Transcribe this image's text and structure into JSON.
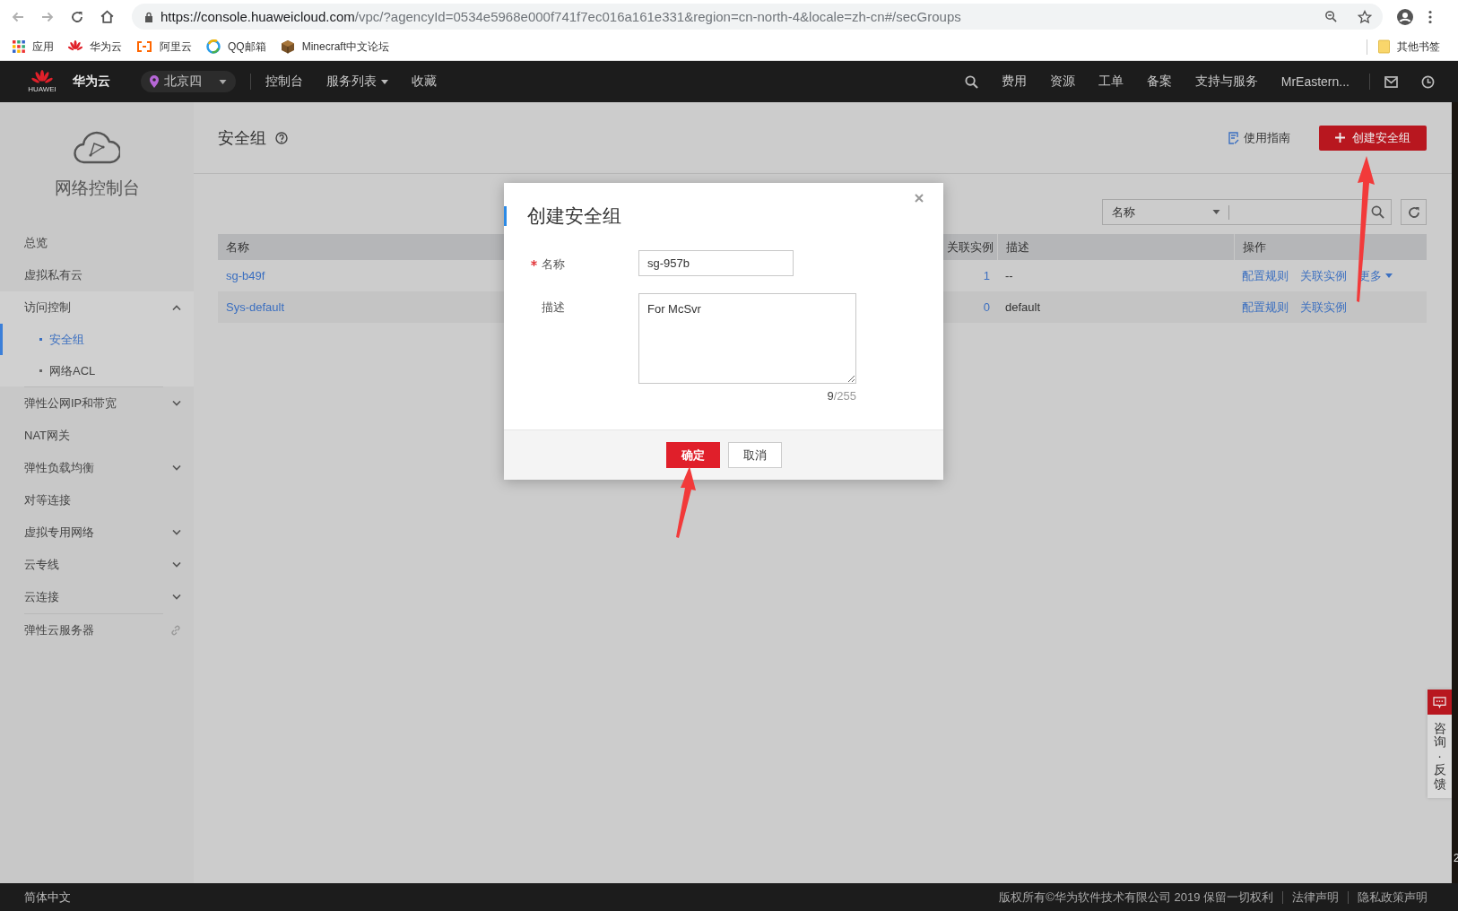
{
  "browser": {
    "url": {
      "host": "https://console.huaweicloud.com",
      "rest": "/vpc/?agencyId=0534e5968e000f741f7ec016a161e331&region=cn-north-4&locale=zh-cn#/secGroups"
    },
    "bookmarks": [
      {
        "label": "应用",
        "kind": "apps"
      },
      {
        "label": "华为云",
        "kind": "huawei"
      },
      {
        "label": "阿里云",
        "kind": "aliyun"
      },
      {
        "label": "QQ邮箱",
        "kind": "qqmail"
      },
      {
        "label": "Minecraft中文论坛",
        "kind": "block"
      }
    ],
    "other_bookmarks": "其他书签"
  },
  "header": {
    "logo_text": "HUAWEI",
    "brand": "华为云",
    "region": "北京四",
    "nav": [
      {
        "label": "控制台",
        "dropdown": false
      },
      {
        "label": "服务列表",
        "dropdown": true
      },
      {
        "label": "收藏",
        "dropdown": false
      }
    ],
    "links": [
      "费用",
      "资源",
      "工单",
      "备案",
      "支持与服务"
    ],
    "user": "MrEastern..."
  },
  "sidebar": {
    "title": "网络控制台",
    "items": [
      {
        "label": "总览",
        "kind": "plain",
        "selected": false
      },
      {
        "label": "虚拟私有云",
        "kind": "plain",
        "selected": false
      },
      {
        "label": "访问控制",
        "kind": "group",
        "expanded": true,
        "selected": false,
        "children": [
          {
            "label": "安全组",
            "selected": true
          },
          {
            "label": "网络ACL",
            "selected": false
          }
        ]
      },
      {
        "label": "弹性公网IP和带宽",
        "kind": "group",
        "expanded": false,
        "selected": false
      },
      {
        "label": "NAT网关",
        "kind": "plain",
        "selected": false
      },
      {
        "label": "弹性负载均衡",
        "kind": "group",
        "expanded": false,
        "selected": false
      },
      {
        "label": "对等连接",
        "kind": "plain",
        "selected": false
      },
      {
        "label": "虚拟专用网络",
        "kind": "group",
        "expanded": false,
        "selected": false
      },
      {
        "label": "云专线",
        "kind": "group",
        "expanded": false,
        "selected": false
      },
      {
        "label": "云连接",
        "kind": "group",
        "expanded": false,
        "selected": false
      },
      {
        "label": "弹性云服务器",
        "kind": "external",
        "selected": false
      }
    ]
  },
  "page": {
    "title": "安全组",
    "guide": "使用指南",
    "create": "创建安全组"
  },
  "filter": {
    "field": "名称"
  },
  "table": {
    "columns": [
      "名称",
      "关联实例",
      "描述",
      "操作"
    ],
    "rows": [
      {
        "name": "sg-b49f",
        "instances": "1",
        "description": "--",
        "actions": [
          {
            "label": "配置规则",
            "dropdown": false
          },
          {
            "label": "关联实例",
            "dropdown": false
          },
          {
            "label": "更多",
            "dropdown": true
          }
        ]
      },
      {
        "name": "Sys-default",
        "instances": "0",
        "description": "default",
        "actions": [
          {
            "label": "配置规则",
            "dropdown": false
          },
          {
            "label": "关联实例",
            "dropdown": false
          }
        ]
      }
    ]
  },
  "dialog": {
    "title": "创建安全组",
    "fields": [
      {
        "label": "名称",
        "kind": "input",
        "required": true,
        "value": "sg-957b"
      },
      {
        "label": "描述",
        "kind": "textarea",
        "required": false,
        "value": "For McSvr",
        "counter": "**9**/255"
      }
    ],
    "buttons": [
      {
        "label": "确定",
        "primary": true
      },
      {
        "label": "取消",
        "primary": false
      }
    ]
  },
  "feedback": "咨询·反馈",
  "edge_text": "2",
  "footer": {
    "language": "简体中文",
    "copyright": "版权所有©华为软件技术有限公司 2019 保留一切权利",
    "links": [
      "法律声明",
      "隐私政策声明"
    ]
  }
}
